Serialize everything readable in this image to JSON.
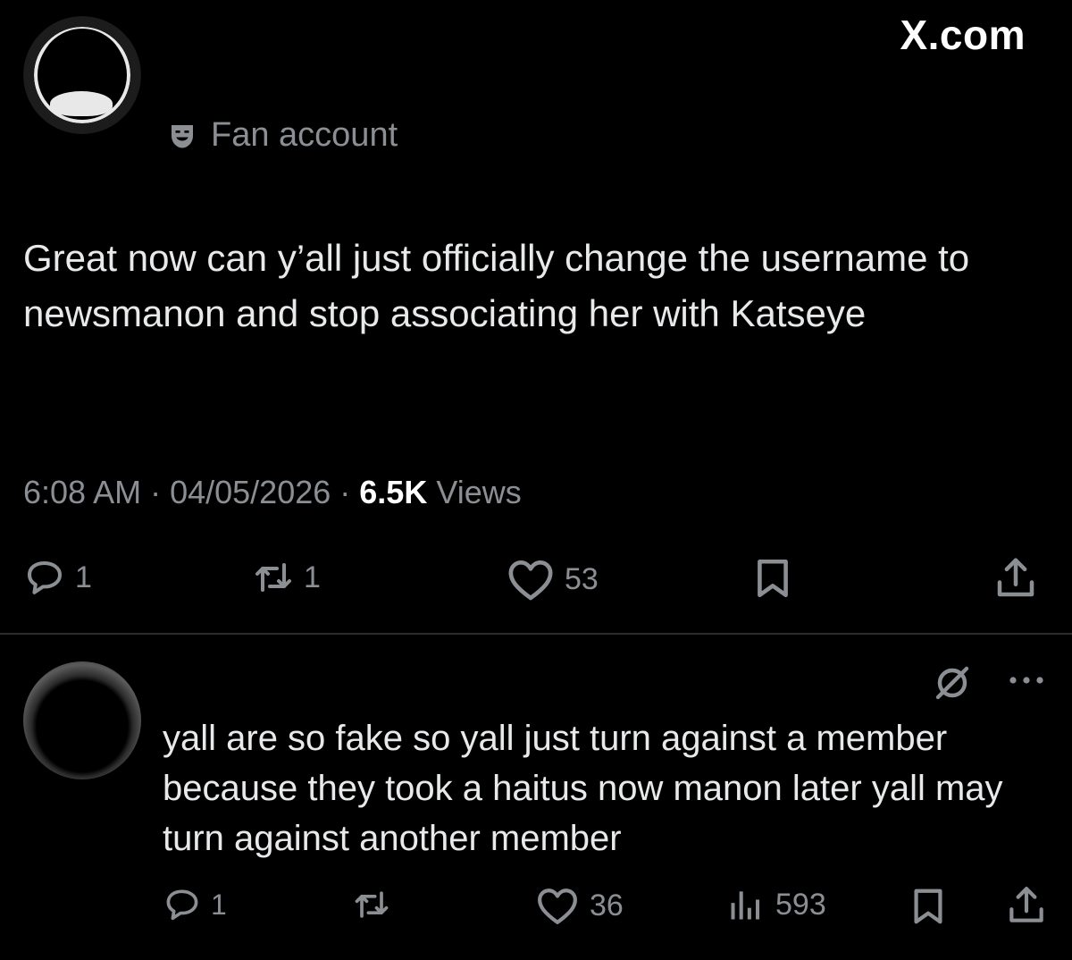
{
  "header": {
    "site": "X.com"
  },
  "post": {
    "badge_label": "Fan account",
    "text": "Great now can y’all just officially change the username to newsmanon and stop associating her with Katseye",
    "time": "6:08 AM",
    "sep1": " · ",
    "date": "04/05/2026",
    "sep2": " · ",
    "views_count": "6.5K",
    "views_label": " Views",
    "actions": {
      "replies": "1",
      "reposts": "1",
      "likes": "53"
    }
  },
  "reply": {
    "text": "yall are so fake so yall just turn against a member because they took a haitus now manon later yall may turn against another member",
    "actions": {
      "replies": "1",
      "likes": "36",
      "views": "593"
    }
  },
  "icons": {
    "badge": "theater-mask-icon",
    "reply": "speech-bubble-icon",
    "repost": "repost-icon",
    "like": "heart-icon",
    "bookmark": "bookmark-icon",
    "share": "share-icon",
    "grok": "grok-icon",
    "more": "more-icon",
    "views": "bar-chart-icon"
  },
  "colors": {
    "background": "#000000",
    "text": "#e7e9ea",
    "muted": "#8b8f94"
  }
}
